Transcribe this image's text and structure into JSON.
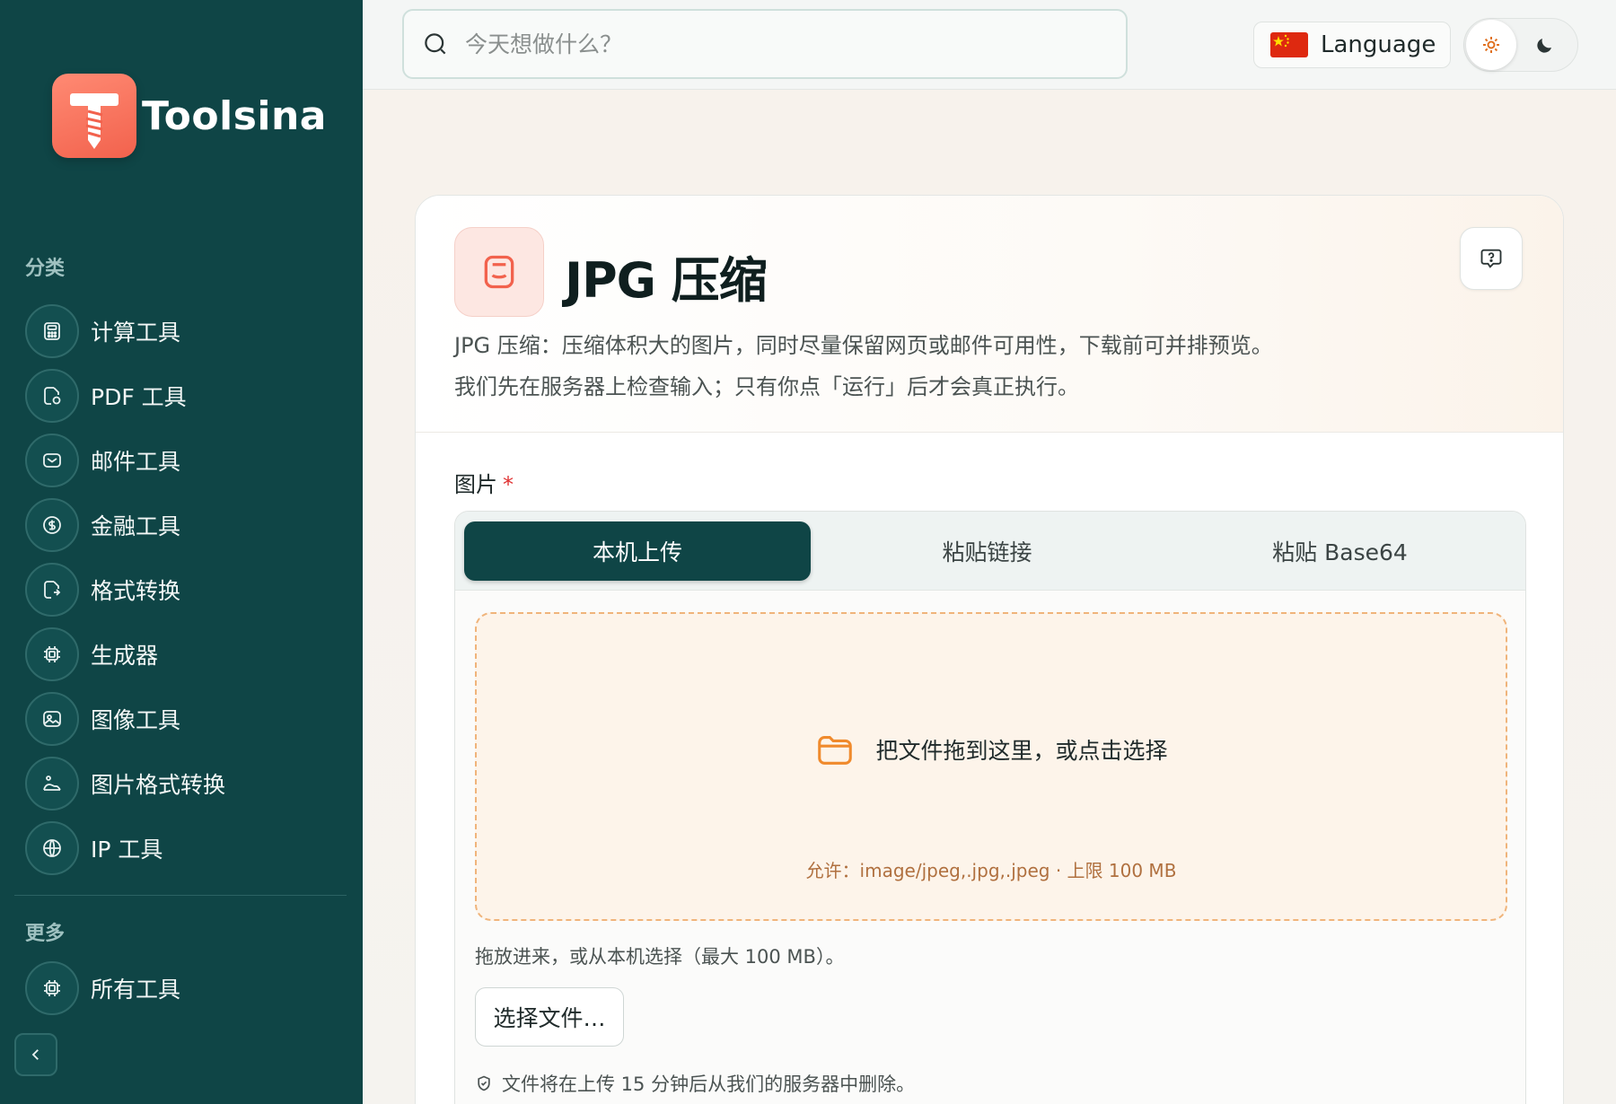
{
  "brand": {
    "name": "Toolsina"
  },
  "sidebar": {
    "categories_label": "分类",
    "items": [
      {
        "label": "计算工具",
        "icon": "calculator-icon"
      },
      {
        "label": "PDF 工具",
        "icon": "pdf-file-icon"
      },
      {
        "label": "邮件工具",
        "icon": "mail-icon"
      },
      {
        "label": "金融工具",
        "icon": "dollar-icon"
      },
      {
        "label": "格式转换",
        "icon": "convert-file-icon"
      },
      {
        "label": "生成器",
        "icon": "chip-icon"
      },
      {
        "label": "图像工具",
        "icon": "image-icon"
      },
      {
        "label": "图片格式转换",
        "icon": "image-convert-icon"
      },
      {
        "label": "IP 工具",
        "icon": "globe-icon"
      }
    ],
    "more_label": "更多",
    "more_items": [
      {
        "label": "所有工具",
        "icon": "chip-icon"
      }
    ]
  },
  "header": {
    "search_placeholder": "今天想做什么？",
    "language_label": "Language",
    "theme": {
      "active": "light"
    }
  },
  "tool": {
    "title": "JPG 压缩",
    "description_line1": "JPG 压缩：压缩体积大的图片，同时尽量保留网页或邮件可用性，下载前可并排预览。",
    "description_line2": "我们先在服务器上检查输入；只有你点「运行」后才会真正执行。"
  },
  "form": {
    "image_label": "图片",
    "required_mark": "*",
    "tabs": [
      {
        "label": "本机上传",
        "active": true
      },
      {
        "label": "粘贴链接",
        "active": false
      },
      {
        "label": "粘贴 Base64",
        "active": false
      }
    ],
    "dropzone_text": "把文件拖到这里，或点击选择",
    "dropzone_allowed": "允许：image/jpeg,.jpg,.jpeg · 上限 100 MB",
    "hint": "拖放进来，或从本机选择（最大 100 MB）。",
    "choose_button": "选择文件…",
    "delete_notice": "文件将在上传 15 分钟后从我们的服务器中删除。"
  },
  "colors": {
    "sidebar_bg": "#0f4546",
    "accent": "#0f4546",
    "brand_coral": "#f2624d",
    "dropzone_border": "#f0b47b"
  }
}
